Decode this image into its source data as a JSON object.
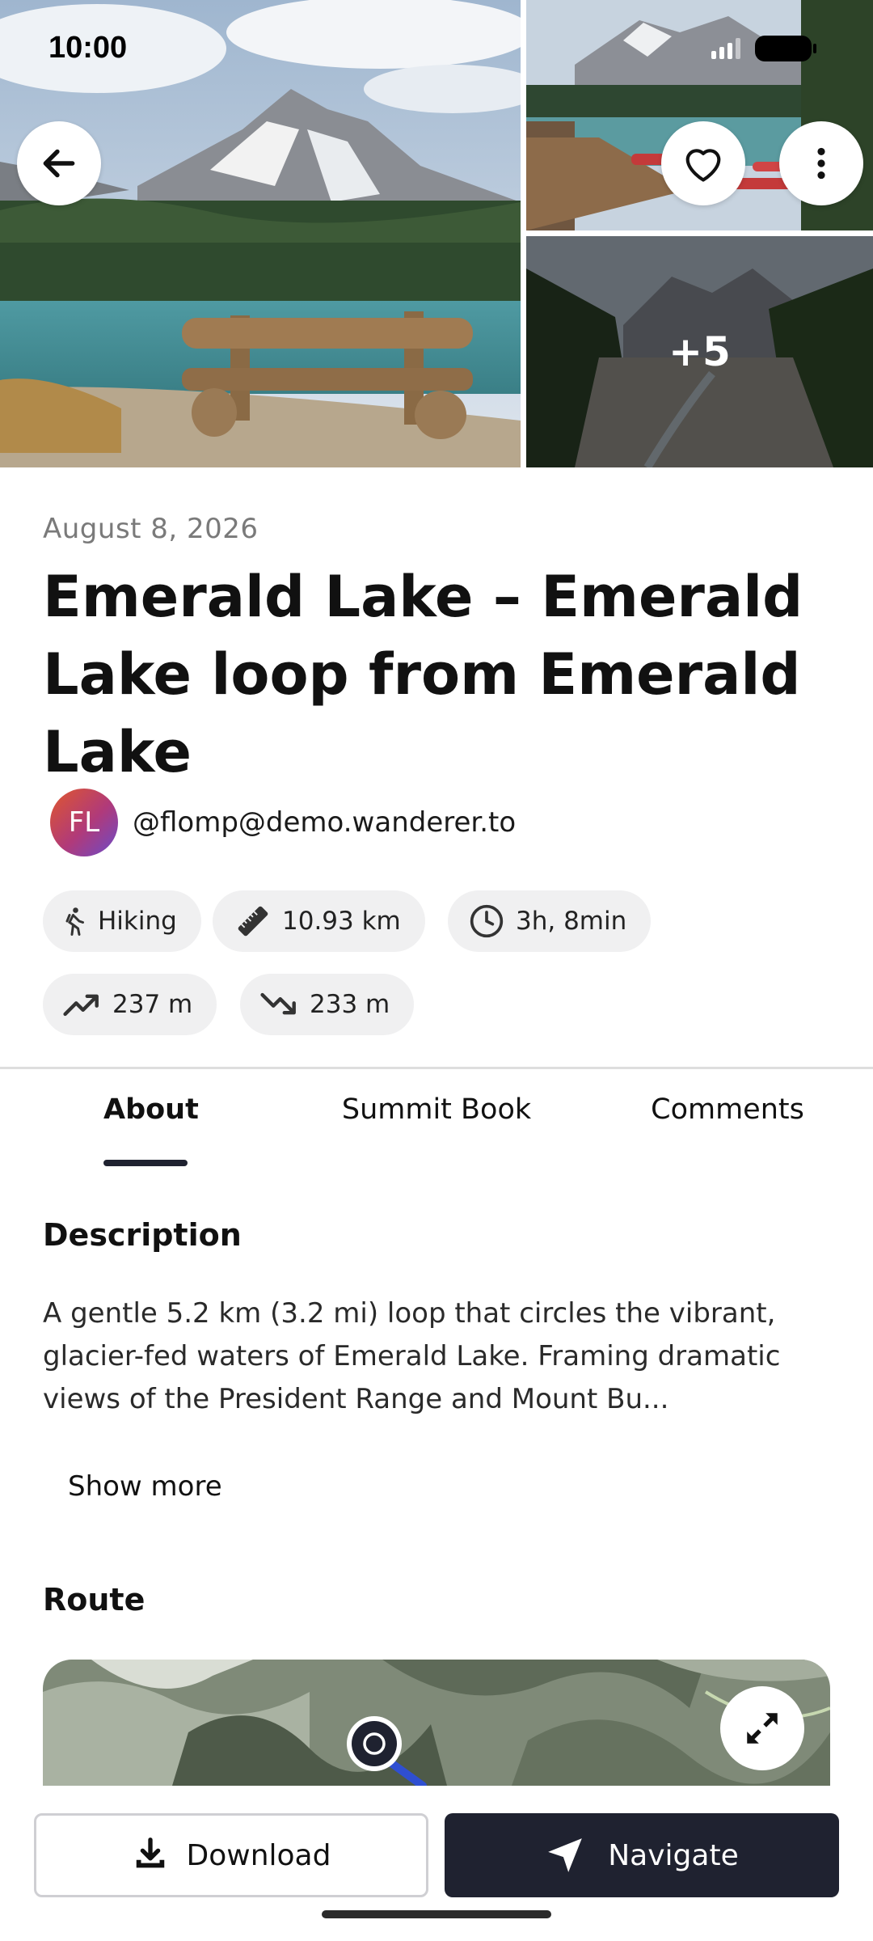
{
  "status_bar": {
    "time": "10:00"
  },
  "gallery": {
    "more_count_label": "+5"
  },
  "trail": {
    "date": "August 8, 2026",
    "title": "Emerald Lake – Emerald Lake loop from Emerald Lake",
    "author": {
      "initials": "FL",
      "handle": "@flomp@demo.wanderer.to"
    }
  },
  "stats": {
    "activity": "Hiking",
    "distance": "10.93 km",
    "duration": "3h, 8min",
    "elevation_gain": "237 m",
    "elevation_loss": "233 m"
  },
  "tabs": [
    {
      "label": "About",
      "active": true
    },
    {
      "label": "Summit Book",
      "active": false
    },
    {
      "label": "Comments",
      "active": false
    }
  ],
  "description": {
    "heading": "Description",
    "text": "A gentle 5.2 km (3.2 mi) loop that circles the vibrant, glacier-fed waters of Emerald Lake. Framing dramatic views of the President Range and Mount Bu...",
    "show_more_label": "Show more"
  },
  "route": {
    "heading": "Route"
  },
  "actions": {
    "download_label": "Download",
    "navigate_label": "Navigate"
  },
  "colors": {
    "primary_dark": "#1f2230",
    "chip_bg": "#f0f0f1",
    "muted_text": "#7a7a7a"
  },
  "icons": [
    "back-arrow-icon",
    "heart-icon",
    "kebab-menu-icon",
    "hiking-icon",
    "ruler-icon",
    "clock-icon",
    "trend-up-icon",
    "trend-down-icon",
    "expand-icon",
    "download-icon",
    "navigate-arrow-icon"
  ]
}
